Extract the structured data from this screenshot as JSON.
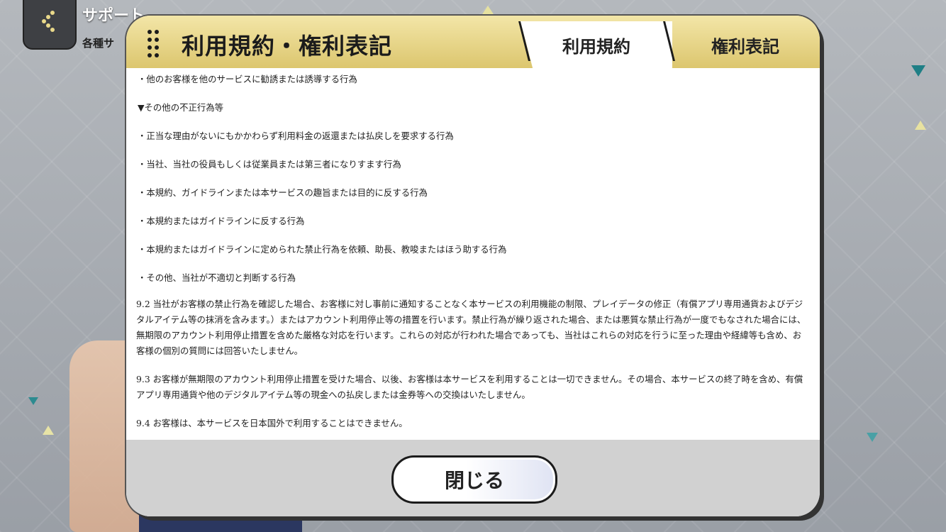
{
  "header": {
    "title": "サポート",
    "subtitle": "各種サ"
  },
  "dialog": {
    "title": "利用規約・権利表記",
    "tabs": [
      {
        "label": "利用規約",
        "active": true
      },
      {
        "label": "権利表記",
        "active": false
      }
    ],
    "lines": [
      "・他のお客様を他のサービスに勧誘または誘導する行為",
      "▼その他の不正行為等",
      "・正当な理由がないにもかかわらず利用料金の返還または払戻しを要求する行為",
      "・当社、当社の役員もしくは従業員または第三者になりすます行為",
      "・本規約、ガイドラインまたは本サービスの趣旨または目的に反する行為",
      "・本規約またはガイドラインに反する行為",
      "・本規約またはガイドラインに定められた禁止行為を依頼、助長、教唆またはほう助する行為",
      "・その他、当社が不適切と判断する行為"
    ],
    "paragraphs": [
      "9.2 当社がお客様の禁止行為を確認した場合、お客様に対し事前に通知することなく本サービスの利用機能の制限、プレイデータの修正（有償アプリ専用通貨およびデジタルアイテム等の抹消を含みます。）またはアカウント利用停止等の措置を行います。禁止行為が繰り返された場合、または悪質な禁止行為が一度でもなされた場合には、無期限のアカウント利用停止措置を含めた厳格な対応を行います。これらの対応が行われた場合であっても、当社はこれらの対応を行うに至った理由や経緯等も含め、お客様の個別の質問には回答いたしません。",
      "9.3 お客様が無期限のアカウント利用停止措置を受けた場合、以後、お客様は本サービスを利用することは一切できません。その場合、本サービスの終了時を含め、有償アプリ専用通貨や他のデジタルアイテム等の現金への払戻しまたは金券等への交換はいたしません。",
      "9.4 お客様は、本サービスを日本国外で利用することはできません。"
    ],
    "close_label": "閉じる"
  },
  "colors": {
    "header_gold_light": "#f3e6a8",
    "header_gold_dark": "#dcc66e",
    "footer_gray": "#d1d1d1",
    "back_button": "#3e4044"
  }
}
